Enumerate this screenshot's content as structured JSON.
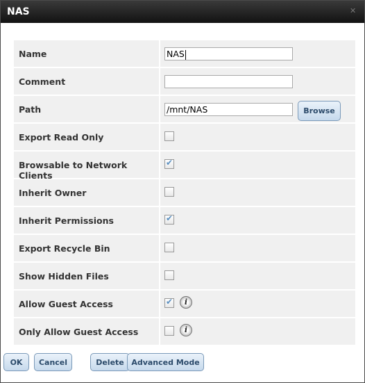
{
  "window": {
    "title": "NAS"
  },
  "fields": {
    "name": {
      "label": "Name",
      "value": "NAS"
    },
    "comment": {
      "label": "Comment",
      "value": ""
    },
    "path": {
      "label": "Path",
      "value": "/mnt/NAS"
    }
  },
  "browse_label": "Browse",
  "checkboxes": [
    {
      "label": "Export Read Only",
      "checked": false
    },
    {
      "label": "Browsable to Network Clients",
      "checked": true
    },
    {
      "label": "Inherit Owner",
      "checked": false
    },
    {
      "label": "Inherit Permissions",
      "checked": true
    },
    {
      "label": "Export Recycle Bin",
      "checked": false
    },
    {
      "label": "Show Hidden Files",
      "checked": false
    },
    {
      "label": "Allow Guest Access",
      "checked": true,
      "info": true
    },
    {
      "label": "Only Allow Guest Access",
      "checked": false,
      "info": true
    }
  ],
  "buttons": {
    "ok": "OK",
    "cancel": "Cancel",
    "delete": "Delete",
    "advanced": "Advanced Mode"
  },
  "icons": {
    "close": "close-icon",
    "info": "info-icon",
    "check": "checkmark-icon"
  }
}
